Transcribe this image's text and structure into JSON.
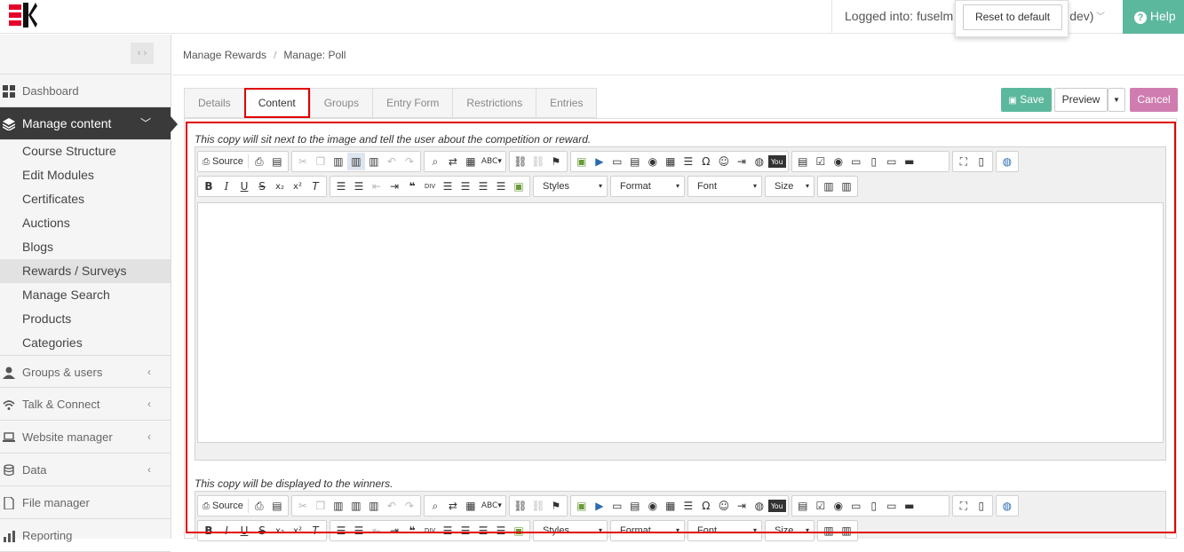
{
  "header": {
    "logged_in_label": "Logged into: fuselm",
    "logged_in_suffix": "dev)",
    "help_label": "Help",
    "reset_label": "Reset to default"
  },
  "sidebar": {
    "items": [
      {
        "label": "Dashboard"
      },
      {
        "label": "Manage content"
      },
      {
        "label": "Groups & users"
      },
      {
        "label": "Talk & Connect"
      },
      {
        "label": "Website manager"
      },
      {
        "label": "Data"
      },
      {
        "label": "File manager"
      },
      {
        "label": "Reporting"
      }
    ],
    "sub_items": [
      {
        "label": "Course Structure"
      },
      {
        "label": "Edit Modules"
      },
      {
        "label": "Certificates"
      },
      {
        "label": "Auctions"
      },
      {
        "label": "Blogs"
      },
      {
        "label": "Rewards / Surveys"
      },
      {
        "label": "Manage Search"
      },
      {
        "label": "Products"
      },
      {
        "label": "Categories"
      }
    ]
  },
  "breadcrumb": [
    "Manage Rewards",
    "Manage: Poll"
  ],
  "tabs": [
    {
      "label": "Details"
    },
    {
      "label": "Content"
    },
    {
      "label": "Groups"
    },
    {
      "label": "Entry Form"
    },
    {
      "label": "Restrictions"
    },
    {
      "label": "Entries"
    }
  ],
  "actions": {
    "save": "Save",
    "preview": "Preview",
    "cancel": "Cancel"
  },
  "editors": [
    {
      "label": "This copy will sit next to the image and tell the user about the competition or reward."
    },
    {
      "label": "This copy will be displayed to the winners."
    }
  ],
  "toolbar": {
    "source": "Source",
    "styles": "Styles",
    "format": "Format",
    "font": "Font",
    "size": "Size"
  },
  "colors": {
    "accent_green": "#5cb89d",
    "cancel_pink": "#cf7db0",
    "highlight_red": "#e00000",
    "logo_red": "#e4002b"
  }
}
